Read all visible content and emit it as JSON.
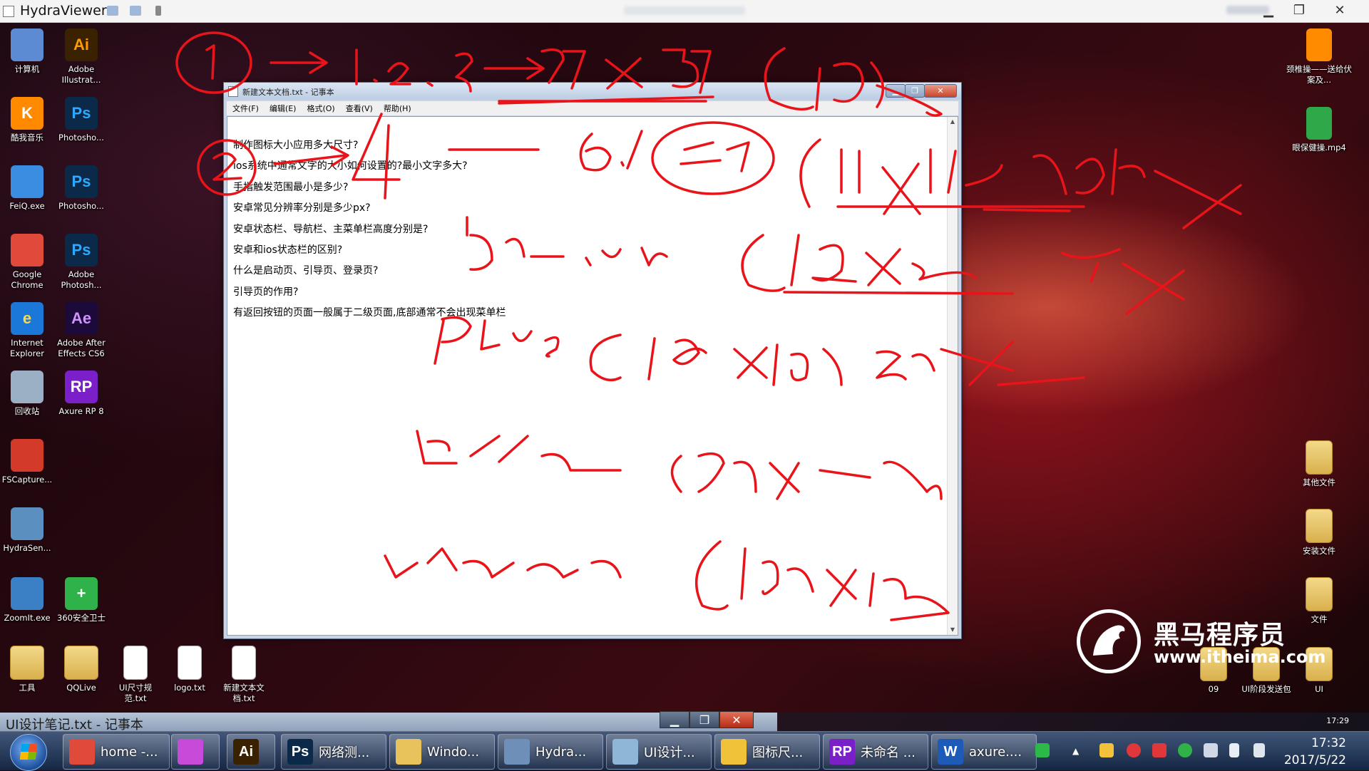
{
  "viewer": {
    "title": "HydraViewer"
  },
  "desktop_left": [
    {
      "name": "computer",
      "label": "计算机",
      "glyph": "",
      "color": "#5d8bd3"
    },
    {
      "name": "illustrator",
      "label": "Adobe Illustrat...",
      "glyph": "Ai",
      "color": "#3a2200",
      "fg": "#ff9a00"
    },
    {
      "name": "kuwo",
      "label": "酷我音乐",
      "glyph": "K",
      "color": "#ff8a00",
      "fg": "#fff"
    },
    {
      "name": "photoshop-1",
      "label": "Photosho...",
      "glyph": "Ps",
      "color": "#0b2a4a",
      "fg": "#31a8ff"
    },
    {
      "name": "feiq",
      "label": "FeiQ.exe",
      "glyph": "",
      "color": "#3a8de0"
    },
    {
      "name": "photoshop-2",
      "label": "Photosho...",
      "glyph": "Ps",
      "color": "#0b2a4a",
      "fg": "#31a8ff"
    },
    {
      "name": "chrome",
      "label": "Google Chrome",
      "glyph": "",
      "color": "#e04a3a"
    },
    {
      "name": "photoshop-3",
      "label": "Adobe Photosh...",
      "glyph": "Ps",
      "color": "#0b2a4a",
      "fg": "#31a8ff"
    },
    {
      "name": "ie",
      "label": "Internet Explorer",
      "glyph": "e",
      "color": "#1b78d8",
      "fg": "#ffd84a"
    },
    {
      "name": "after-effects",
      "label": "Adobe After Effects CS6",
      "glyph": "Ae",
      "color": "#1b0a3a",
      "fg": "#d291ff"
    },
    {
      "name": "recycle-bin",
      "label": "回收站",
      "glyph": "",
      "color": "#9bb0c4"
    },
    {
      "name": "axure",
      "label": "Axure RP 8",
      "glyph": "RP",
      "color": "#7b1fc9",
      "fg": "#fff"
    },
    {
      "name": "fscapture",
      "label": "FSCapture...",
      "glyph": "",
      "color": "#d43a2a"
    },
    {
      "name": "hydrasender",
      "label": "HydraSen...",
      "glyph": "",
      "color": "#5a8fc0"
    },
    {
      "name": "zoomit",
      "label": "ZoomIt.exe",
      "glyph": "",
      "color": "#3b7fc4"
    },
    {
      "name": "360",
      "label": "360安全卫士",
      "glyph": "+",
      "color": "#2fb24a",
      "fg": "#fff"
    },
    {
      "name": "tools",
      "label": "工具",
      "glyph": "",
      "color": "folder"
    },
    {
      "name": "qqlive",
      "label": "QQLive",
      "glyph": "",
      "color": "folder"
    },
    {
      "name": "ui-size-txt",
      "label": "UI尺寸规范.txt",
      "glyph": "",
      "color": "paper"
    },
    {
      "name": "logo-txt",
      "label": "logo.txt",
      "glyph": "",
      "color": "paper"
    },
    {
      "name": "new-txt",
      "label": "新建文本文档.txt",
      "glyph": "",
      "color": "paper"
    }
  ],
  "desktop_right": [
    {
      "name": "vlc",
      "label": "颈椎操——送给伏案及...",
      "glyph": "",
      "color": "#ff8c00"
    },
    {
      "name": "eye-exercise",
      "label": "眼保健操.mp4",
      "glyph": "",
      "color": "#2fa84a"
    },
    {
      "name": "other-files",
      "label": "其他文件",
      "glyph": "",
      "color": "folder"
    },
    {
      "name": "install-files",
      "label": "安装文件",
      "glyph": "",
      "color": "folder"
    },
    {
      "name": "files",
      "label": "文件",
      "glyph": "",
      "color": "folder"
    },
    {
      "name": "folder-09",
      "label": "09",
      "glyph": "",
      "color": "folder"
    },
    {
      "name": "ui-stage",
      "label": "UI阶段发送包",
      "glyph": "",
      "color": "folder"
    },
    {
      "name": "ui",
      "label": "UI",
      "glyph": "",
      "color": "folder"
    }
  ],
  "notepad": {
    "title": "新建文本文档.txt - 记事本",
    "menu": [
      "文件(F)",
      "编辑(E)",
      "格式(O)",
      "查看(V)",
      "帮助(H)"
    ],
    "lines": [
      "制作图标大小应用多大尺寸?",
      "ios系统中通常文字的大小如何设置的?最小文字多大?",
      "手指触发范围最小是多少?",
      "安卓常见分辨率分别是多少px?",
      "安卓状态栏、导航栏、主菜单栏高度分别是?",
      "安卓和ios状态栏的区别?",
      "什么是启动页、引导页、登录页?",
      "引导页的作用?",
      "有返回按钮的页面一般属于二级页面,底部通常不会出现菜单栏"
    ]
  },
  "strip": {
    "title": "UI设计笔记.txt - 记事本",
    "tray_time": "17:29"
  },
  "taskbar": {
    "items": [
      {
        "name": "chrome",
        "label": "home -...",
        "icon": "#e04a3a",
        "glyph": ""
      },
      {
        "name": "picasa",
        "label": "",
        "icon": "#c84ad8",
        "glyph": ""
      },
      {
        "name": "illustrator",
        "label": "",
        "icon": "#3a2200",
        "glyph": "Ai"
      },
      {
        "name": "photoshop",
        "label": "网络测...",
        "icon": "#0b2a4a",
        "glyph": "Ps"
      },
      {
        "name": "explorer",
        "label": "Windo...",
        "icon": "#e8c25a",
        "glyph": ""
      },
      {
        "name": "hydra",
        "label": "Hydra...",
        "icon": "#6e8fb8",
        "glyph": ""
      },
      {
        "name": "notepad",
        "label": "UI设计...",
        "icon": "#8fb6d6",
        "glyph": ""
      },
      {
        "name": "icon-size",
        "label": "图标尺...",
        "icon": "#f0c23a",
        "glyph": ""
      },
      {
        "name": "axure",
        "label": "未命名 ...",
        "icon": "#7b1fc9",
        "glyph": "RP"
      },
      {
        "name": "word",
        "label": "axure....",
        "icon": "#1e5bb8",
        "glyph": "W"
      }
    ],
    "time": "17:32",
    "date": "2017/5/22"
  },
  "logo": {
    "cn": "黑马程序员",
    "url": "www.itheima.com"
  }
}
